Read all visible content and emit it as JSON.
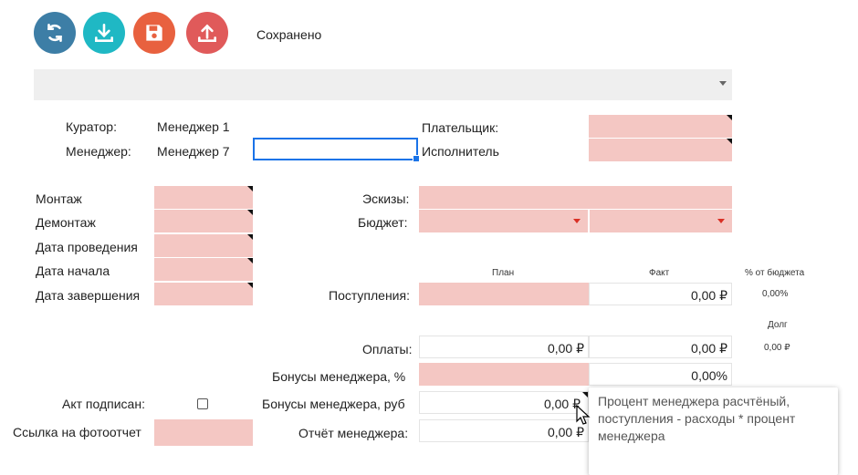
{
  "toolbar": {
    "buttons": [
      {
        "icon": "refresh-icon",
        "color": "#3d7ea6"
      },
      {
        "icon": "download-icon",
        "color": "#1fb8c4"
      },
      {
        "icon": "floppy-disk-icon",
        "color": "#e8613f"
      },
      {
        "icon": "upload-icon",
        "color": "#e05a5a"
      }
    ],
    "status": "Сохранено"
  },
  "header": {
    "curator_label": "Куратор:",
    "curator_value": "Менеджер 1",
    "manager_label": "Менеджер:",
    "manager_value": "Менеджер 7",
    "payer_label": "Плательщик:",
    "executor_label": "Исполнитель"
  },
  "dates": {
    "mounting": "Монтаж",
    "dismounting": "Демонтаж",
    "event_date": "Дата проведения",
    "start_date": "Дата начала",
    "end_date": "Дата завершения"
  },
  "project": {
    "sketches_label": "Эскизы:",
    "budget_label": "Бюджет:"
  },
  "finance": {
    "plan_header": "План",
    "fact_header": "Факт",
    "percent_header": "% от бюджета",
    "debt_header": "Долг",
    "income_label": "Поступления:",
    "income_fact": "0,00 ₽",
    "income_percent": "0,00%",
    "payments_label": "Оплаты:",
    "payments_plan": "0,00 ₽",
    "payments_fact": "0,00 ₽",
    "payments_debt": "0,00 ₽",
    "bonus_pct_label": "Бонусы менеджера, %",
    "bonus_pct_fact": "0,00%",
    "bonus_rub_label": "Бонусы менеджера, руб",
    "bonus_rub_plan": "0,00 ₽",
    "report_label": "Отчёт менеджера:",
    "report_plan": "0,00 ₽"
  },
  "footer": {
    "act_signed_label": "Акт подписан:",
    "photo_report_label": "Ссылка на фотоотчет"
  },
  "tooltip": {
    "text": "Процент менеджера расчтёный, поступления - расходы * процент менеджера"
  }
}
